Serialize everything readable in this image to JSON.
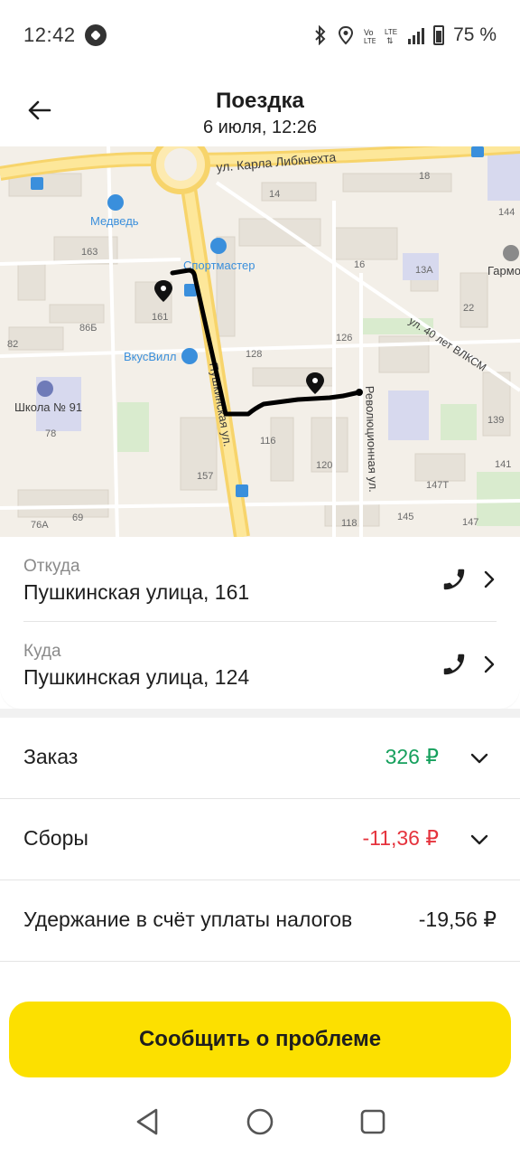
{
  "status_bar": {
    "time": "12:42",
    "battery": "75 %",
    "icons": [
      "notification-icon",
      "bluetooth-icon",
      "location-icon",
      "volte-icon",
      "lte-icon",
      "signal-icon",
      "battery-icon"
    ]
  },
  "header": {
    "title": "Поездка",
    "subtitle": "6 июля, 12:26",
    "back_icon": "arrow-left-icon"
  },
  "map": {
    "street_labels": {
      "karla": "ул. Карла Либкнехта",
      "pushkinskaya": "Пушкинская ул.",
      "revolyutsionnaya": "Революционная ул.",
      "vlksm": "ул. 40 лет ВЛКСМ"
    },
    "poi": {
      "medved": "Медведь",
      "sportmaster": "Спортмастер",
      "vkusvill": "ВкусВилл",
      "school": "Школа № 91",
      "garmo": "Гармо"
    },
    "house_numbers": [
      "14",
      "18",
      "144",
      "163",
      "16",
      "13А",
      "22",
      "161",
      "86Б",
      "82",
      "128",
      "126",
      "78",
      "116",
      "120",
      "139",
      "141",
      "147Т",
      "157",
      "76А",
      "69",
      "118",
      "145",
      "147"
    ],
    "route_color": "#000000"
  },
  "addresses": {
    "from": {
      "label": "Откуда",
      "value": "Пушкинская улица, 161"
    },
    "to": {
      "label": "Куда",
      "value": "Пушкинская улица, 124"
    }
  },
  "finance": {
    "order": {
      "label": "Заказ",
      "value": "326 ₽",
      "color": "#16a05d"
    },
    "fees": {
      "label": "Сборы",
      "value": "-11,36 ₽",
      "color": "#e5333d"
    },
    "tax": {
      "label": "Удержание в счёт уплаты налогов",
      "value": "-19,56 ₽",
      "color": "#1e1e1e"
    }
  },
  "actions": {
    "report_label": "Сообщить о проблеме",
    "accent": "#fce000"
  },
  "nav": {
    "icons": [
      "back-triangle-icon",
      "home-circle-icon",
      "recents-square-icon"
    ]
  }
}
